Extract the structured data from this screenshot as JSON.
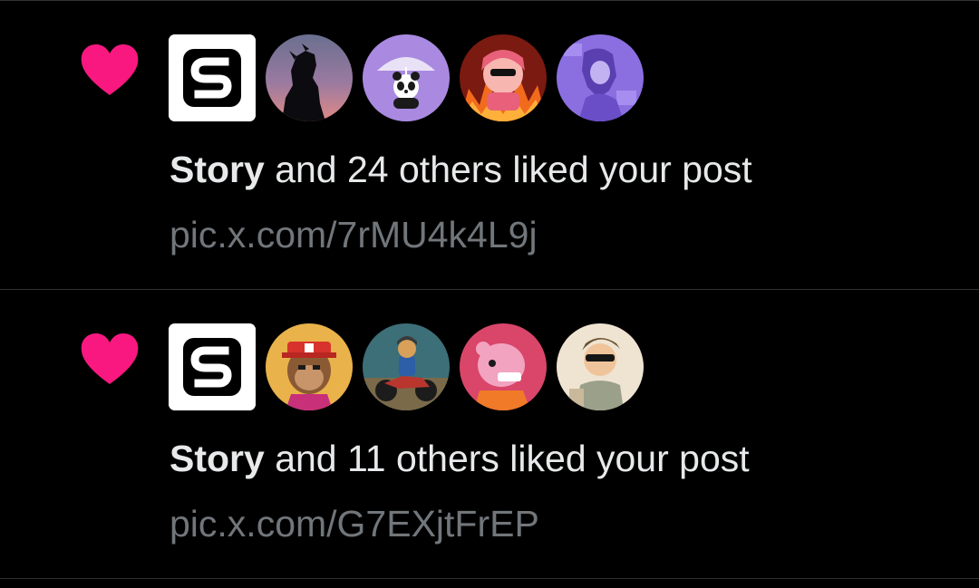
{
  "colors": {
    "background": "#000000",
    "divider": "#2f3336",
    "heart": "#f91880",
    "primary_text": "#e7e9ea",
    "secondary_text": "#71767b"
  },
  "notifications": [
    {
      "icon": "heart-icon",
      "name": "Story",
      "action_text": " and 24 others liked your post",
      "link": "pic.x.com/7rMU4k4L9j",
      "avatars": [
        {
          "kind": "logo-s",
          "label": "S"
        },
        {
          "kind": "silhouette-sunset"
        },
        {
          "kind": "panda-umbrella"
        },
        {
          "kind": "pink-character-fire"
        },
        {
          "kind": "purple-character"
        }
      ]
    },
    {
      "icon": "heart-icon",
      "name": "Story",
      "action_text": " and 11 others liked your post",
      "link": "pic.x.com/G7EXjtFrEP",
      "avatars": [
        {
          "kind": "logo-s",
          "label": "S"
        },
        {
          "kind": "pixel-ape-red-hat"
        },
        {
          "kind": "motorcycle-rider"
        },
        {
          "kind": "pink-bear"
        },
        {
          "kind": "sunglasses-boy"
        }
      ]
    }
  ]
}
